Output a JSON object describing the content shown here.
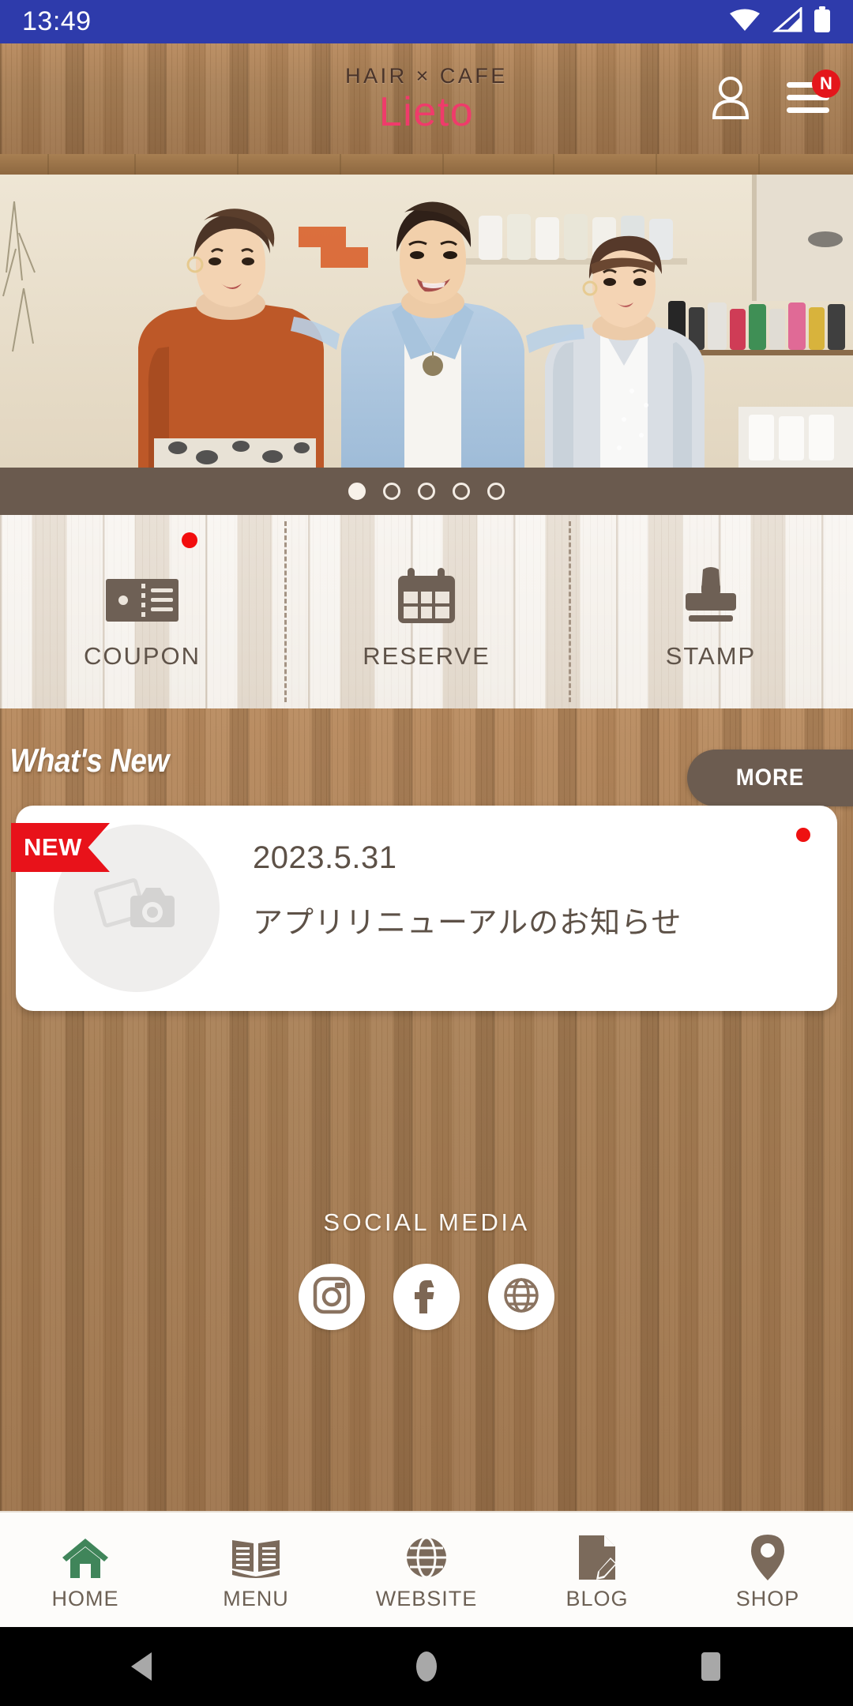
{
  "status_bar": {
    "time": "13:49",
    "icons": [
      "wifi-icon",
      "signal-icon",
      "battery-icon"
    ],
    "background": "#2e3bab"
  },
  "header": {
    "logo_top": "HAIR × CAFE",
    "logo_main": "Lieto",
    "logo_color": "#ef3b6b",
    "account_icon": "person-icon",
    "menu_icon": "hamburger-menu-icon",
    "menu_badge": "N",
    "badge_color": "#e4161b"
  },
  "carousel": {
    "slide_count": 5,
    "active_index": 0,
    "bar_color": "#6a5a4e",
    "alt": "Three hair salon staff members standing together in the salon"
  },
  "quick_actions": {
    "items": [
      {
        "label": "COUPON",
        "icon": "coupon-ticket-icon",
        "has_notification": true
      },
      {
        "label": "RESERVE",
        "icon": "calendar-icon",
        "has_notification": false
      },
      {
        "label": "STAMP",
        "icon": "stamp-icon",
        "has_notification": false
      }
    ],
    "icon_color": "#6e6055",
    "notification_color": "#f20d0d"
  },
  "whats_new": {
    "title": "What's New",
    "more_label": "MORE",
    "more_color": "#6c5c50",
    "items": [
      {
        "badge": "NEW",
        "badge_color": "#e8121a",
        "date": "2023.5.31",
        "text": "アプリリニューアルのお知らせ",
        "thumbnail_icon": "photo-camera-placeholder-icon",
        "unread": true
      }
    ]
  },
  "social_media": {
    "label": "SOCIAL MEDIA",
    "items": [
      {
        "name": "instagram-icon"
      },
      {
        "name": "facebook-icon"
      },
      {
        "name": "website-globe-icon"
      }
    ]
  },
  "bottom_nav": {
    "active_index": 0,
    "active_color": "#40855a",
    "inactive_color": "#7b6a5b",
    "items": [
      {
        "label": "HOME",
        "icon": "home-icon"
      },
      {
        "label": "MENU",
        "icon": "book-icon"
      },
      {
        "label": "WEBSITE",
        "icon": "globe-icon"
      },
      {
        "label": "BLOG",
        "icon": "document-pencil-icon"
      },
      {
        "label": "SHOP",
        "icon": "map-pin-icon"
      }
    ]
  },
  "android_nav": {
    "items": [
      {
        "name": "back-button"
      },
      {
        "name": "home-button"
      },
      {
        "name": "recents-button"
      }
    ]
  }
}
